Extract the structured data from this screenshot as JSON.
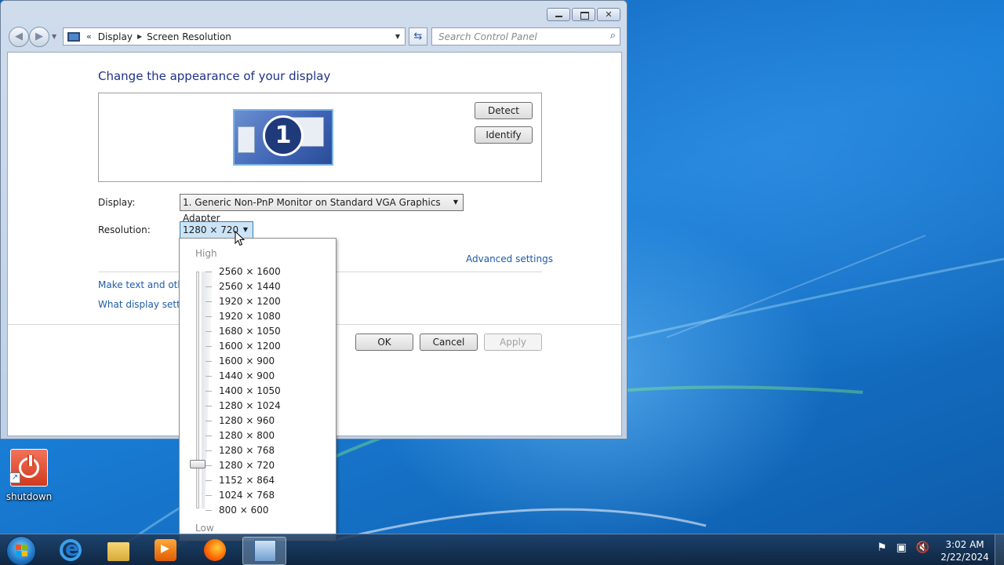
{
  "window": {
    "address": {
      "parent": "Display",
      "current": "Screen Resolution"
    },
    "search_placeholder": "Search Control Panel",
    "heading": "Change the appearance of your display",
    "monitor_number": "1",
    "buttons": {
      "detect": "Detect",
      "identify": "Identify",
      "ok": "OK",
      "cancel": "Cancel",
      "apply": "Apply"
    },
    "display_label": "Display:",
    "display_value": "1. Generic Non-PnP Monitor on Standard VGA Graphics Adapter",
    "resolution_label": "Resolution:",
    "resolution_value": "1280 × 720",
    "advanced_link": "Advanced settings",
    "links": [
      "Make text and other",
      "What display setting"
    ]
  },
  "resolution_dropdown": {
    "high_label": "High",
    "low_label": "Low",
    "options": [
      "2560 × 1600",
      "2560 × 1440",
      "1920 × 1200",
      "1920 × 1080",
      "1680 × 1050",
      "1600 × 1200",
      "1600 × 900",
      "1440 × 900",
      "1400 × 1050",
      "1280 × 1024",
      "1280 × 960",
      "1280 × 800",
      "1280 × 768",
      "1280 × 720",
      "1152 × 864",
      "1024 × 768",
      "800 × 600"
    ],
    "selected": "1280 × 720"
  },
  "desktop": {
    "icon_label": "shutdown"
  },
  "taskbar": {
    "items": [
      "internet-explorer",
      "windows-explorer",
      "media-player",
      "firefox",
      "control-panel"
    ],
    "active_item": "control-panel",
    "time": "3:02 AM",
    "date": "2/22/2024"
  }
}
